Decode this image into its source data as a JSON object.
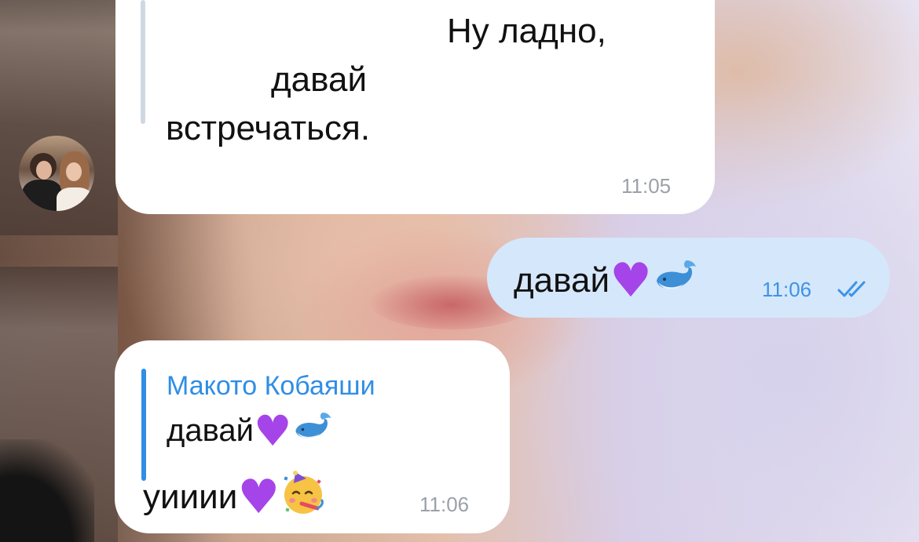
{
  "chat": {
    "messages": [
      {
        "direction": "incoming",
        "lines": [
          "Ну ладно,",
          "давай",
          "встречаться."
        ],
        "time": "11:05"
      },
      {
        "direction": "outgoing",
        "text": "давай",
        "time": "11:06",
        "status": "read"
      },
      {
        "direction": "incoming",
        "reply": {
          "author": "Макото Кобаяши",
          "text": "давай"
        },
        "text": "уииии",
        "time": "11:06"
      }
    ]
  },
  "icons": {
    "heart": "purple-heart-icon",
    "whale": "whale-icon",
    "party": "partying-face-icon",
    "read_status": "double-check-icon"
  },
  "colors": {
    "incoming_bubble": "#ffffff",
    "outgoing_bubble": "#d5e7fb",
    "accent": "#2f8ee6",
    "heart": "#a544e8"
  }
}
